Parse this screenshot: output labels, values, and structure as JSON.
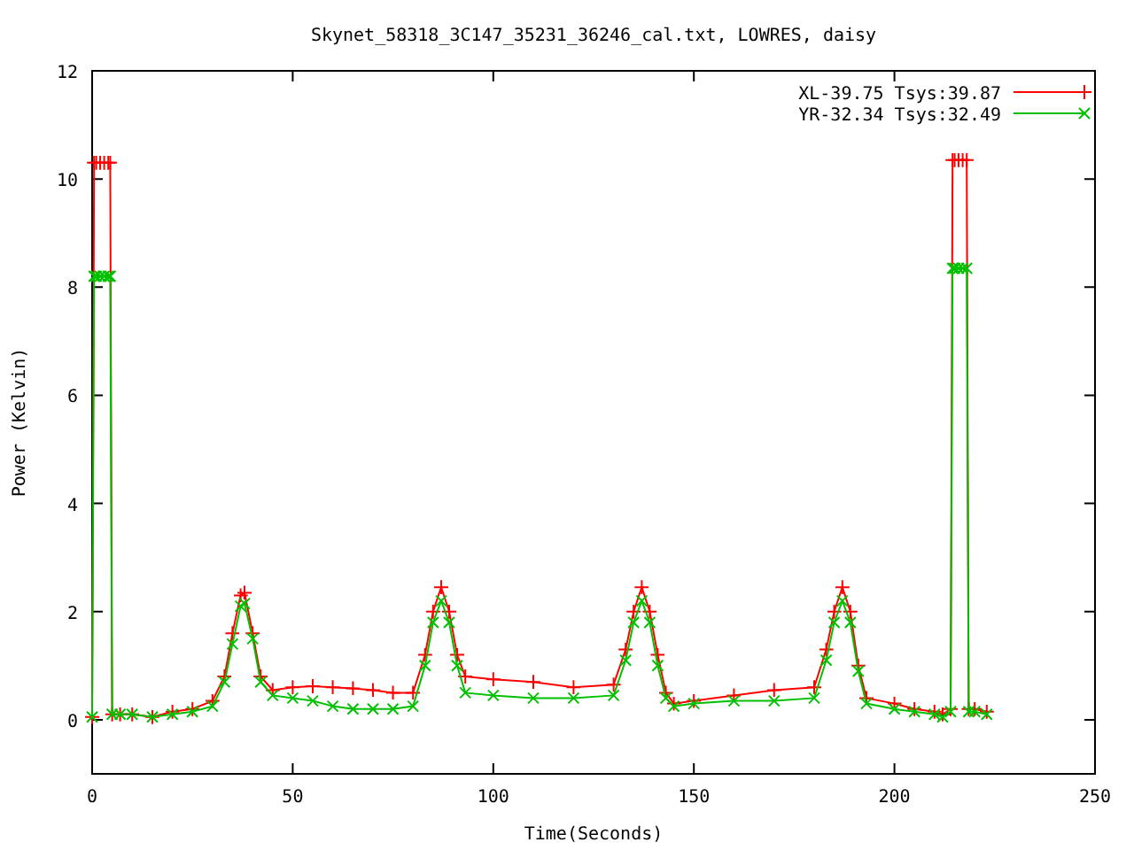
{
  "plot": {
    "chart_data": {
      "type": "line",
      "legend": true,
      "title": "Skynet_58318_3C147_35231_36246_cal.txt, LOWRES, daisy",
      "xlabel": "Time(Seconds)",
      "ylabel": "Power (Kelvin)",
      "xlim": [
        0,
        250
      ],
      "ylim": [
        -1,
        12
      ],
      "xticks": [
        0,
        50,
        100,
        150,
        200,
        250
      ],
      "yticks": [
        0,
        2,
        4,
        6,
        8,
        10,
        12
      ],
      "x": [
        0,
        0.5,
        1,
        2,
        3,
        4,
        4.5,
        5,
        7,
        10,
        15,
        20,
        25,
        30,
        33,
        35,
        37,
        38,
        40,
        42,
        45,
        50,
        55,
        60,
        65,
        70,
        75,
        80,
        83,
        85,
        87,
        89,
        91,
        93,
        100,
        110,
        120,
        130,
        133,
        135,
        137,
        139,
        141,
        143,
        145,
        150,
        160,
        170,
        180,
        183,
        185,
        187,
        189,
        191,
        193,
        200,
        205,
        210,
        212,
        214,
        214.5,
        215,
        216,
        217,
        218,
        218.5,
        220,
        223
      ],
      "series": [
        {
          "name": "XL-39.75 Tsys:39.87",
          "color": "#ff0000",
          "values": [
            0.05,
            10.3,
            10.3,
            10.3,
            10.3,
            10.3,
            10.3,
            0.1,
            0.1,
            0.1,
            0.05,
            0.15,
            0.2,
            0.35,
            0.8,
            1.6,
            2.3,
            2.35,
            1.6,
            0.8,
            0.55,
            0.6,
            0.62,
            0.6,
            0.58,
            0.55,
            0.5,
            0.5,
            1.2,
            2.0,
            2.45,
            2.0,
            1.2,
            0.8,
            0.75,
            0.7,
            0.6,
            0.65,
            1.3,
            2.0,
            2.45,
            2.0,
            1.2,
            0.5,
            0.3,
            0.35,
            0.45,
            0.55,
            0.6,
            1.3,
            2.0,
            2.45,
            2.0,
            1.0,
            0.4,
            0.3,
            0.2,
            0.15,
            0.1,
            0.2,
            10.35,
            10.35,
            10.35,
            10.35,
            10.35,
            0.2,
            0.2,
            0.15
          ]
        },
        {
          "name": "YR-32.34 Tsys:32.49",
          "color": "#00c000",
          "values": [
            0.05,
            8.2,
            8.2,
            8.2,
            8.2,
            8.2,
            8.2,
            0.1,
            0.1,
            0.1,
            0.05,
            0.1,
            0.15,
            0.25,
            0.7,
            1.4,
            2.1,
            2.15,
            1.5,
            0.7,
            0.45,
            0.4,
            0.35,
            0.25,
            0.2,
            0.2,
            0.2,
            0.25,
            1.0,
            1.8,
            2.2,
            1.8,
            1.0,
            0.5,
            0.45,
            0.4,
            0.4,
            0.45,
            1.1,
            1.8,
            2.2,
            1.8,
            1.0,
            0.4,
            0.25,
            0.3,
            0.35,
            0.35,
            0.4,
            1.1,
            1.8,
            2.2,
            1.8,
            0.9,
            0.3,
            0.2,
            0.15,
            0.1,
            0.05,
            0.15,
            8.35,
            8.35,
            8.35,
            8.35,
            8.35,
            0.15,
            0.15,
            0.1
          ]
        }
      ]
    }
  }
}
